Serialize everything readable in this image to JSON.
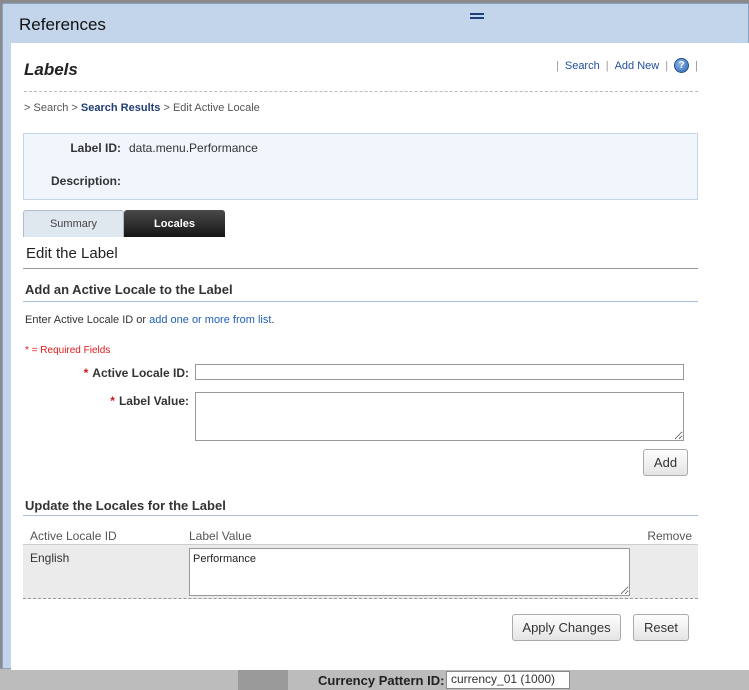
{
  "dialog": {
    "title": "References"
  },
  "panel": {
    "title": "Labels"
  },
  "top_links": {
    "search": "Search",
    "add_new": "Add New",
    "help": "?"
  },
  "breadcrumb": {
    "items": [
      {
        "label": "Search"
      },
      {
        "label": "Search Results"
      },
      {
        "label": "Edit Active Locale"
      }
    ],
    "separator": ">"
  },
  "info": {
    "label_id_label": "Label ID:",
    "label_id_value": "data.menu.Performance",
    "description_label": "Description:",
    "description_value": ""
  },
  "tabs": [
    {
      "label": "Summary",
      "active": false
    },
    {
      "label": "Locales",
      "active": true
    }
  ],
  "edit": {
    "heading": "Edit the Label",
    "add_heading": "Add an Active Locale to the Label",
    "hint_prefix": "Enter Active Locale ID or ",
    "hint_link": "add one or more from list",
    "hint_suffix": ".",
    "required_note": "* = Required Fields",
    "required_star": "*",
    "locale_id_label": "Active Locale ID:",
    "locale_id_value": "",
    "label_value_label": "Label Value:",
    "label_value_value": "",
    "add_button": "Add"
  },
  "update": {
    "heading": "Update the Locales for the Label",
    "columns": [
      "Active Locale ID",
      "Label Value",
      "Remove"
    ],
    "rows": [
      {
        "locale": "English",
        "value": "Performance"
      }
    ]
  },
  "actions": {
    "apply": "Apply Changes",
    "reset": "Reset"
  },
  "background": {
    "field_label": "Currency Pattern ID:",
    "field_value": "currency_01 (1000)"
  }
}
